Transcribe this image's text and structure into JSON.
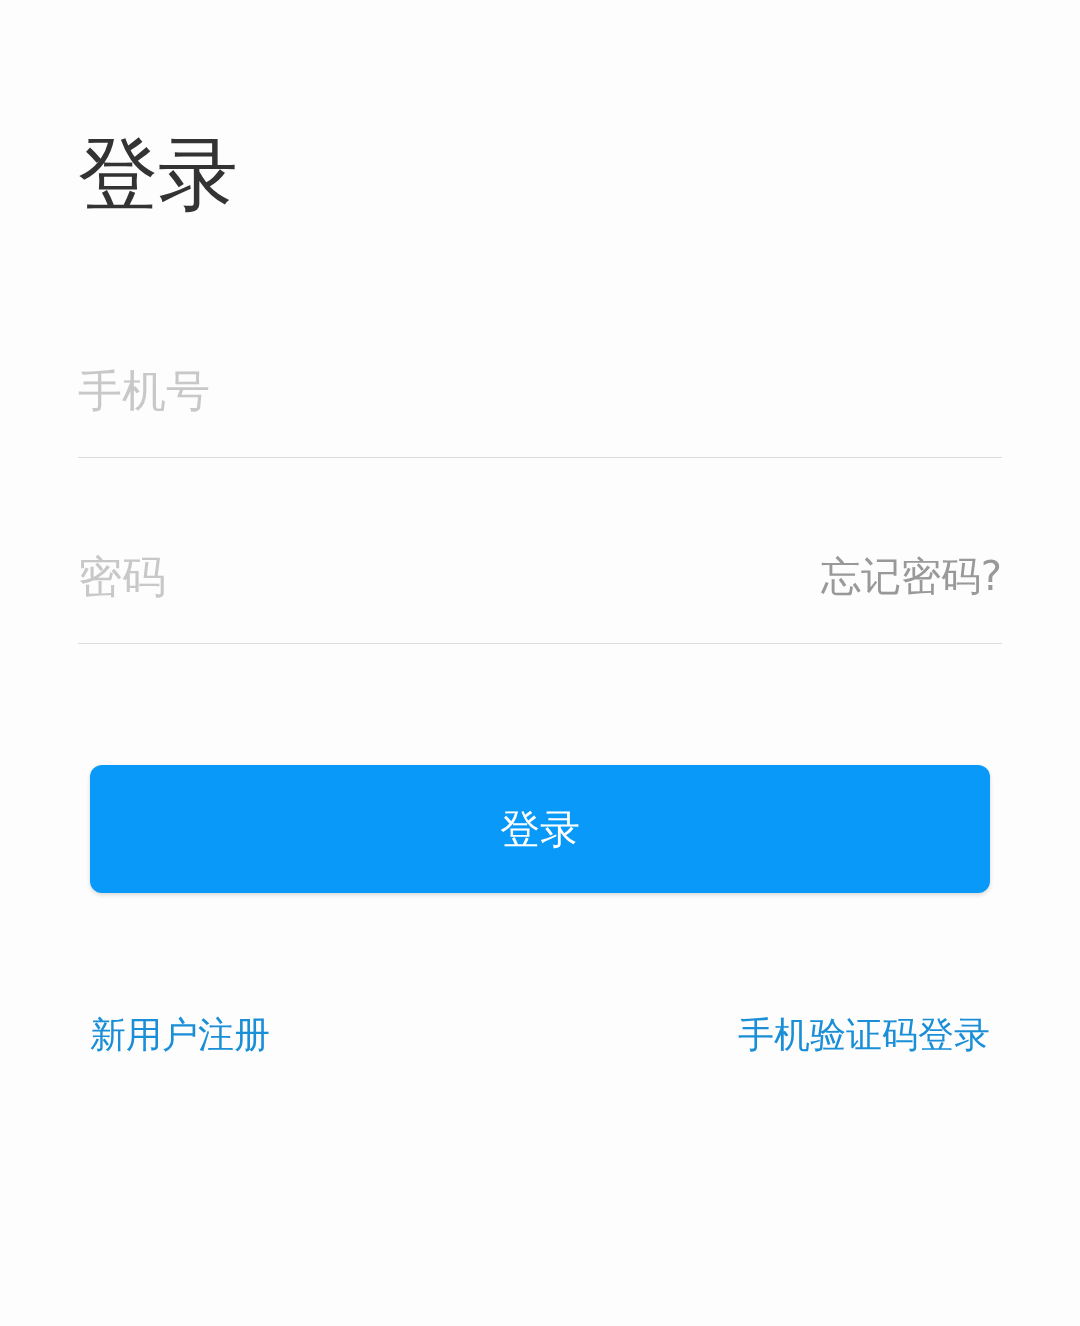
{
  "title": "登录",
  "fields": [
    {
      "placeholder": "手机号"
    },
    {
      "placeholder": "密码",
      "action": "忘记密码?"
    }
  ],
  "login_button": "登录",
  "links": [
    "新用户注册",
    "手机验证码登录"
  ]
}
